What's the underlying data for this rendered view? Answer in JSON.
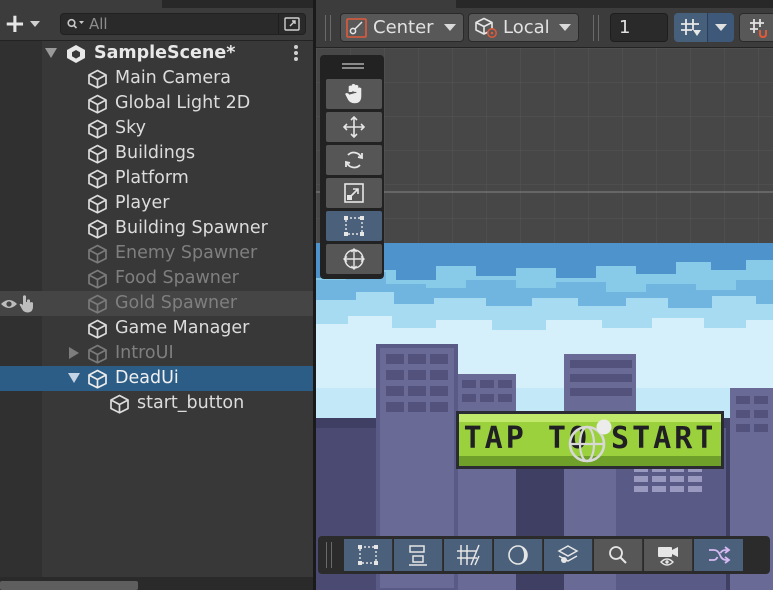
{
  "hierarchy": {
    "search": {
      "placeholder": "All"
    },
    "scene_name": "SampleScene*",
    "items": [
      {
        "label": "Main Camera",
        "state": "normal"
      },
      {
        "label": "Global Light 2D",
        "state": "normal"
      },
      {
        "label": "Sky",
        "state": "normal"
      },
      {
        "label": "Buildings",
        "state": "normal"
      },
      {
        "label": "Platform",
        "state": "normal"
      },
      {
        "label": "Player",
        "state": "normal"
      },
      {
        "label": "Building Spawner",
        "state": "normal"
      },
      {
        "label": "Enemy Spawner",
        "state": "disabled"
      },
      {
        "label": "Food Spawner",
        "state": "disabled"
      },
      {
        "label": "Gold Spawner",
        "state": "disabled-hover"
      },
      {
        "label": "Game Manager",
        "state": "normal"
      },
      {
        "label": "IntroUI",
        "state": "disabled-collapsed"
      },
      {
        "label": "DeadUi",
        "state": "selected-expanded"
      },
      {
        "label": "start_button",
        "state": "child"
      }
    ]
  },
  "scene_toolbar": {
    "pivot_label": "Center",
    "space_label": "Local",
    "grid_step": "1"
  },
  "scene_view": {
    "button_text": "TAP TO START"
  },
  "tools": [
    "hand-icon",
    "move-icon",
    "rotate-icon",
    "scale-icon",
    "rect-icon",
    "transform-icon"
  ],
  "colors": {
    "selection": "#2c5d87",
    "active_tool": "#4a607b",
    "button_green": "#9bd13c"
  }
}
